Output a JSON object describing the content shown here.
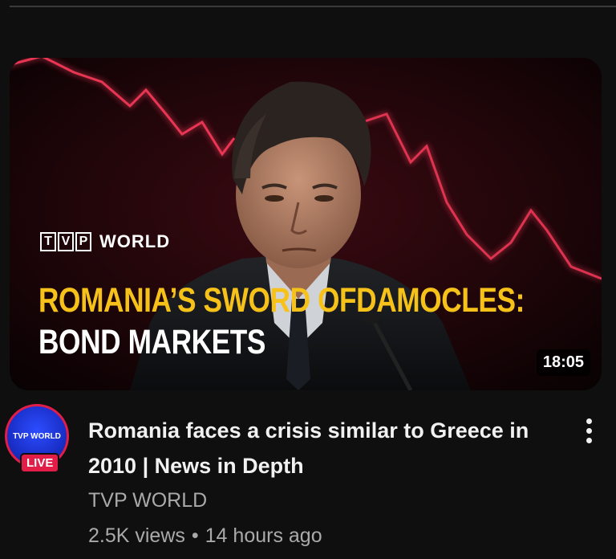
{
  "video": {
    "thumbnail": {
      "brand_tvp_letters": [
        "T",
        "V",
        "P"
      ],
      "brand_world": "WORLD",
      "headline_line1": "ROMANIA’S SWORD OFDAMOCLES:",
      "headline_line2": "BOND MARKETS",
      "duration": "18:05",
      "accent_color": "#f6c21a",
      "chart_line_color": "#ff3b5c"
    },
    "channel_avatar": {
      "text": "TVP WORLD",
      "live_label": "LIVE",
      "ring_color": "#e11d48"
    },
    "title": "Romania faces a crisis similar to Greece in 2010 | News in Depth",
    "channel_name": "TVP WORLD",
    "views": "2.5K views",
    "separator": "•",
    "age": "14 hours ago",
    "more_icon": "vertical-ellipsis-icon"
  }
}
